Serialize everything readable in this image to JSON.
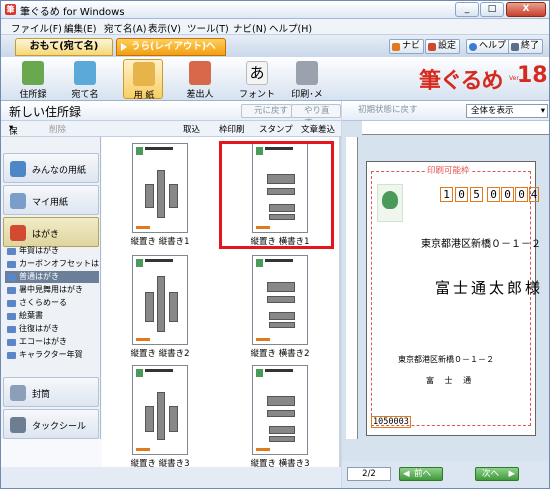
{
  "window": {
    "title": "筆ぐるめ for Windows",
    "min": "_",
    "max": "□",
    "close": "X"
  },
  "menu": [
    "ファイル(F)",
    "編集(E)",
    "宛て名(A)",
    "表示(V)",
    "ツール(T)",
    "ナビ(N)",
    "ヘルプ(H)"
  ],
  "tabs": {
    "front": "おもて(宛て名)",
    "back": "うら(レイアウト)へ切替"
  },
  "top_buttons": {
    "navi": "ナビ",
    "settings": "設定",
    "help": "ヘルプ",
    "exit": "終了"
  },
  "toolbar": [
    {
      "label": "住所録"
    },
    {
      "label": "宛て名"
    },
    {
      "label": "用 紙"
    },
    {
      "label": "差出人"
    },
    {
      "label": "フォント"
    },
    {
      "label": "印刷･メール"
    }
  ],
  "logo": {
    "text": "筆ぐるめ",
    "ver": "18",
    "small": "Ver."
  },
  "address_book": {
    "title": "新しい住所録",
    "undo": "元に戻す",
    "redo": "やり直す",
    "save": "保存",
    "delete": "削除",
    "import": "取込",
    "frame_print": "枠印刷",
    "stamp": "スタンプ",
    "text_insert": "文章差込"
  },
  "sidebar": {
    "big": [
      "みんなの用紙",
      "マイ用紙",
      "はがき",
      "封筒",
      "タックシール"
    ],
    "items": [
      "年賀はがき",
      "カーボンオフセットはがき",
      "普通はがき",
      "暑中見舞用はがき",
      "さくらめーる",
      "絵葉書",
      "往復はがき",
      "エコーはがき",
      "キャラクター年賀"
    ]
  },
  "grid": {
    "labels": [
      "縦置き 縦書き1",
      "縦置き 横書き1",
      "縦置き 縦書き2",
      "縦置き 横書き2",
      "縦置き 縦書き3",
      "縦置き 横書き3"
    ]
  },
  "preview": {
    "reset": "初期状態に戻す",
    "zoom": "全体を表示",
    "print_area": "印刷可能枠",
    "zip_to": [
      "1",
      "0",
      "5",
      "0",
      "0",
      "0",
      "4"
    ],
    "to_address": "東京都港区新橋０－１－２",
    "to_name": "富士通太郎様",
    "from_address": "東京都港区新橋０－１－２",
    "from_name": "富 士 通",
    "from_zip": "1050003",
    "page": "2/2",
    "prev": "前へ",
    "next": "次へ"
  }
}
